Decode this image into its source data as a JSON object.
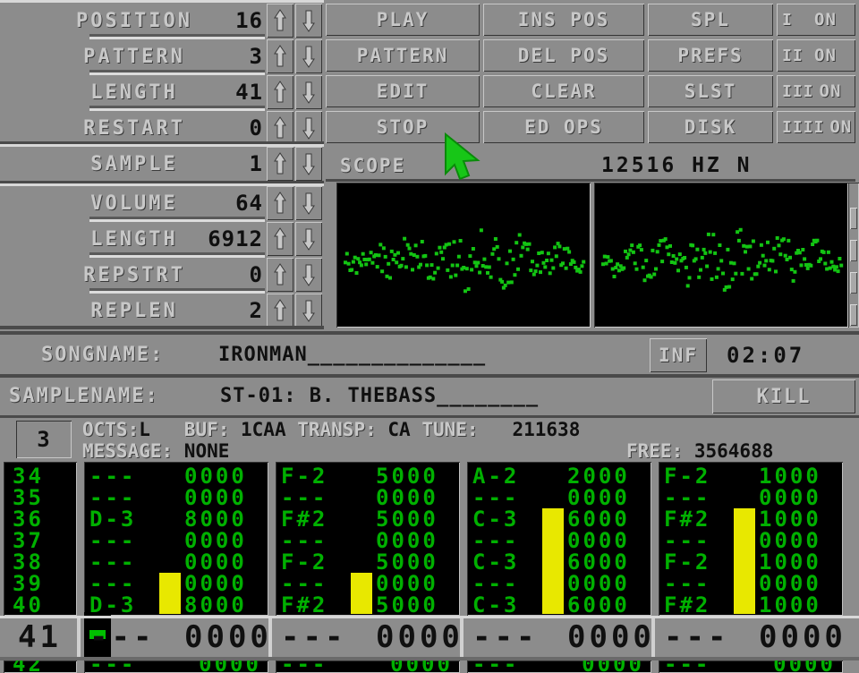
{
  "app": {
    "title": "ProTracker",
    "bg": "#8c8c8c",
    "text_light": "#c8c8c8",
    "text_dark": "#101010",
    "screen_green": "#00b000",
    "vu_yellow": "#e8e800"
  },
  "params": {
    "song": [
      {
        "name": "POSITION",
        "value": "16"
      },
      {
        "name": "PATTERN",
        "value": "3"
      },
      {
        "name": "LENGTH",
        "value": "41"
      },
      {
        "name": "RESTART",
        "value": "0"
      }
    ],
    "sample_select": {
      "name": "SAMPLE",
      "value": "1"
    },
    "sample": [
      {
        "name": "VOLUME",
        "value": "64"
      },
      {
        "name": "LENGTH",
        "value": "6912"
      },
      {
        "name": "REPSTRT",
        "value": "0"
      },
      {
        "name": "REPLEN",
        "value": "2"
      }
    ],
    "up_icon": "arrow-up-icon",
    "down_icon": "arrow-down-icon"
  },
  "commands": {
    "col1": [
      "PLAY",
      "PATTERN",
      "EDIT",
      "STOP"
    ],
    "col2": [
      "INS POS",
      "DEL POS",
      "CLEAR",
      "ED OPS"
    ],
    "col3": [
      "SPL",
      "PREFS",
      "SLST",
      "DISK"
    ],
    "channels": [
      {
        "roman": "I",
        "state": "ON"
      },
      {
        "roman": "II",
        "state": "ON"
      },
      {
        "roman": "III",
        "state": "ON"
      },
      {
        "roman": "IIII",
        "state": "ON"
      }
    ]
  },
  "scope": {
    "label": "SCOPE",
    "rate": "12516",
    "rate_unit": "HZ",
    "video_mode": "N"
  },
  "songname": {
    "label": "SONGNAME:",
    "value": "IRONMAN______________"
  },
  "inf_button": "INF",
  "time": "02:07",
  "samplename": {
    "label": "SAMPLENAME:",
    "value": "ST-01: B. THEBASS________"
  },
  "kill_button": "KILL",
  "info": {
    "edit_octave": "3",
    "octs_label": "OCTS:",
    "octs_value": "L",
    "buf_label": "BUF:",
    "buf_value": "1CAA",
    "transp_label": "TRANSP:",
    "transp_value": "CA",
    "tune_label": "TUNE:",
    "tune_value": "211638",
    "message_label": "MESSAGE:",
    "message_value": "NONE",
    "free_label": "FREE:",
    "free_value": "3564688"
  },
  "pattern": {
    "rows": [
      "34",
      "35",
      "36",
      "37",
      "38",
      "39",
      "40"
    ],
    "channels": [
      {
        "notes": [
          "---",
          "---",
          "D-3",
          "---",
          "---",
          "---",
          "D-3"
        ],
        "data": [
          "0000",
          "0000",
          "8000",
          "0000",
          "0000",
          "0000",
          "8000"
        ],
        "vu_top_row": 5,
        "vu_rows": 2
      },
      {
        "notes": [
          "F-2",
          "---",
          "F#2",
          "---",
          "F-2",
          "---",
          "F#2"
        ],
        "data": [
          "5000",
          "0000",
          "5000",
          "0000",
          "5000",
          "0000",
          "5000"
        ],
        "vu_top_row": 5,
        "vu_rows": 2
      },
      {
        "notes": [
          "A-2",
          "---",
          "C-3",
          "---",
          "C-3",
          "---",
          "C-3"
        ],
        "data": [
          "2000",
          "0000",
          "6000",
          "0000",
          "6000",
          "0000",
          "6000"
        ],
        "vu_top_row": 2,
        "vu_rows": 5
      },
      {
        "notes": [
          "F-2",
          "---",
          "F#2",
          "---",
          "F-2",
          "---",
          "F#2"
        ],
        "data": [
          "1000",
          "0000",
          "1000",
          "0000",
          "1000",
          "0000",
          "1000"
        ],
        "vu_top_row": 2,
        "vu_rows": 5
      }
    ]
  },
  "current_row": {
    "number": "41",
    "channels": [
      {
        "note": "---",
        "data": "0000"
      },
      {
        "note": "---",
        "data": "0000"
      },
      {
        "note": "---",
        "data": "0000"
      },
      {
        "note": "---",
        "data": "0000"
      }
    ]
  }
}
